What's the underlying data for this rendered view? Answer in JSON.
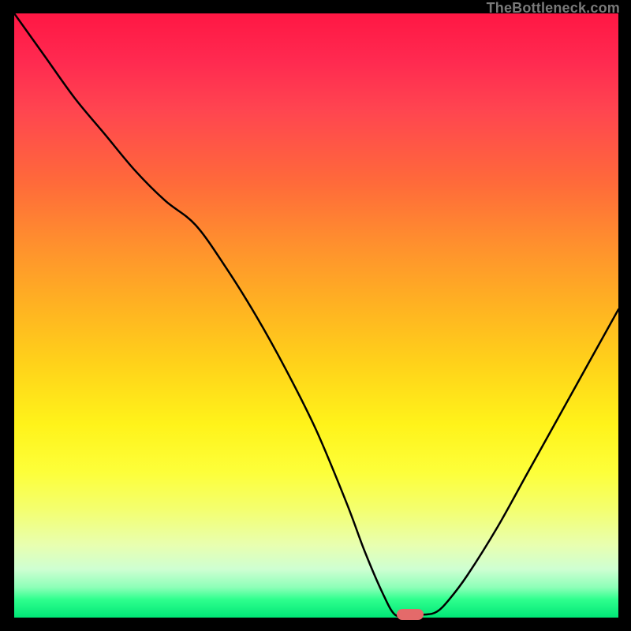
{
  "watermark": "TheBottleneck.com",
  "marker": {
    "x_frac": 0.655,
    "y_frac": 0.995,
    "color": "#e46a6a"
  },
  "chart_data": {
    "type": "line",
    "title": "",
    "xlabel": "",
    "ylabel": "",
    "xlim": [
      0,
      1
    ],
    "ylim": [
      0,
      1
    ],
    "grid": false,
    "legend": false,
    "series": [
      {
        "name": "bottleneck-curve",
        "x": [
          0.0,
          0.05,
          0.1,
          0.15,
          0.2,
          0.25,
          0.3,
          0.35,
          0.4,
          0.45,
          0.5,
          0.55,
          0.58,
          0.61,
          0.63,
          0.65,
          0.68,
          0.7,
          0.72,
          0.75,
          0.8,
          0.85,
          0.9,
          0.95,
          1.0
        ],
        "y": [
          1.0,
          0.93,
          0.86,
          0.8,
          0.74,
          0.69,
          0.65,
          0.58,
          0.5,
          0.41,
          0.31,
          0.19,
          0.11,
          0.04,
          0.005,
          0.005,
          0.005,
          0.01,
          0.03,
          0.07,
          0.15,
          0.24,
          0.33,
          0.42,
          0.51
        ]
      }
    ],
    "gradient_stops": [
      {
        "pos": 0.0,
        "color": "#ff1744"
      },
      {
        "pos": 0.5,
        "color": "#ffd21a"
      },
      {
        "pos": 0.82,
        "color": "#f4ff6e"
      },
      {
        "pos": 1.0,
        "color": "#00e676"
      }
    ]
  }
}
